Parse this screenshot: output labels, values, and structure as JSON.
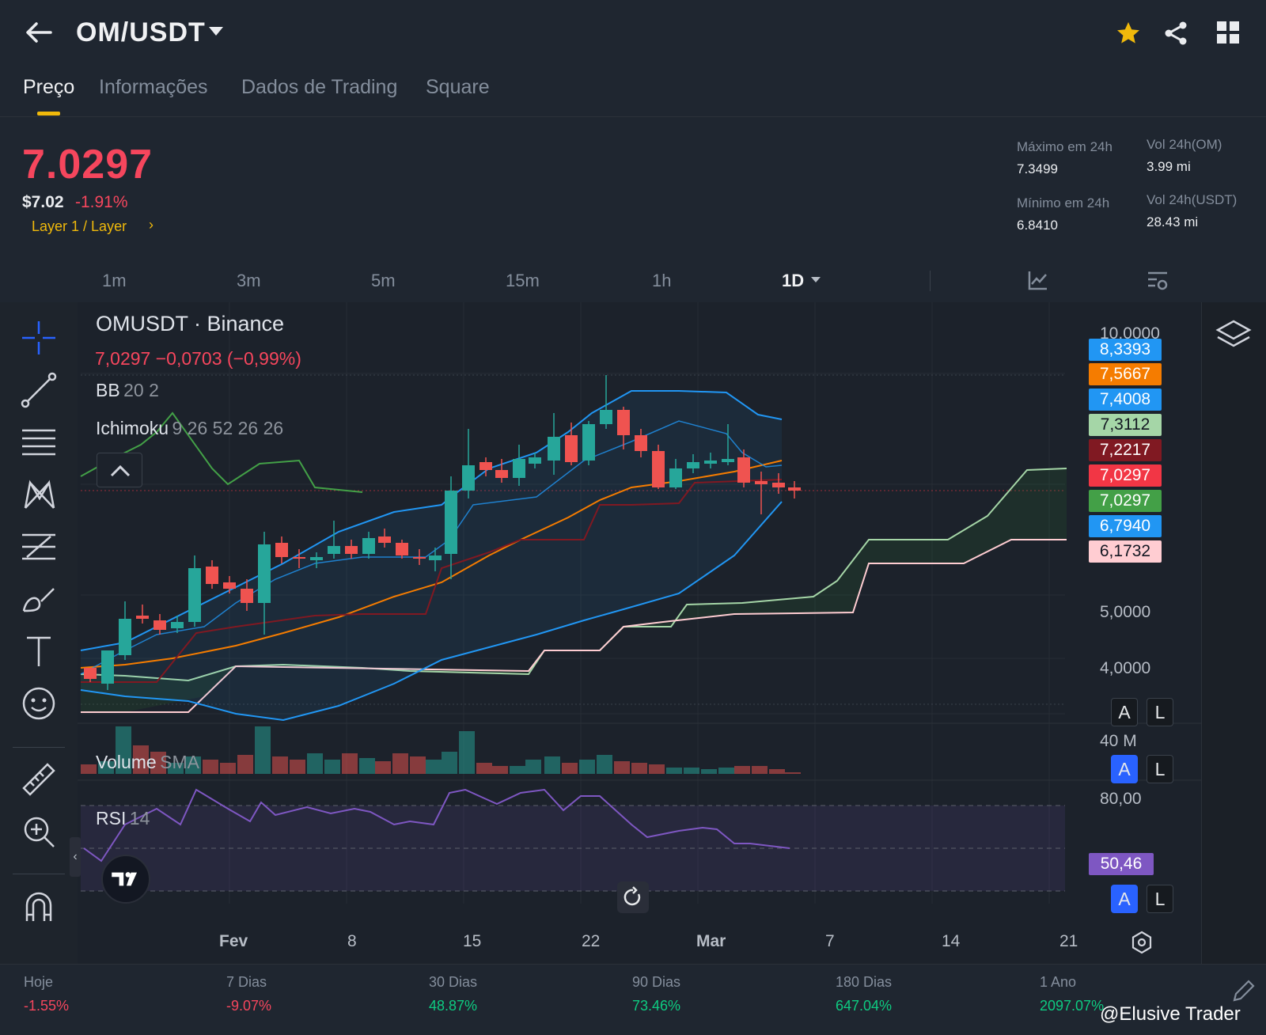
{
  "header": {
    "pair": "OM/USDT",
    "icons": [
      "back-arrow-icon",
      "chevron-down-icon",
      "star-icon",
      "share-icon",
      "grid-icon"
    ],
    "star_color": "#f0b90b"
  },
  "tabs": [
    "Preço",
    "Informações",
    "Dados de Trading",
    "Square"
  ],
  "price": {
    "last": "7.0297",
    "usd": "$7.02",
    "change_pct": "-1.91%",
    "category": "Layer 1 / Layer",
    "color": "#f6465d"
  },
  "stats": {
    "high_label": "Máximo em 24h",
    "high_value": "7.3499",
    "low_label": "Mínimo em 24h",
    "low_value": "6.8410",
    "vol_om_label": "Vol 24h(OM)",
    "vol_om_value": "3.99 mi",
    "vol_usdt_label": "Vol 24h(USDT)",
    "vol_usdt_value": "28.43 mi"
  },
  "intervals": [
    "1m",
    "3m",
    "5m",
    "15m",
    "1h",
    "1D"
  ],
  "chart": {
    "symbol": "OMUSDT · Binance",
    "ohlc_line": "7,0297  −0,0703 (−0,99%)",
    "bb_name": "BB",
    "bb_params": "20 2",
    "ichimoku_name": "Ichimoku",
    "ichimoku_params": "9 26 52 26 26",
    "volume_name": "Volume",
    "volume_params": "SMA",
    "rsi_name": "RSI",
    "rsi_params": "14",
    "rsi_value": "50,46",
    "price_axis": [
      "10,0000",
      "5,0000",
      "4,0000"
    ],
    "volume_axis": "40 M",
    "rsi_axis": "80,00",
    "price_tags": [
      {
        "value": "8,3393",
        "color": "#2196f3"
      },
      {
        "value": "7,5667",
        "color": "#f57c00"
      },
      {
        "value": "7,4008",
        "color": "#2196f3"
      },
      {
        "value": "7,3112",
        "color": "#a5d6a7"
      },
      {
        "value": "7,2217",
        "color": "#801922"
      },
      {
        "value": "7,0297",
        "color": "#f23645"
      },
      {
        "value": "7,0297",
        "color": "#43a047"
      },
      {
        "value": "6,7940",
        "color": "#2196f3"
      },
      {
        "value": "6,1732",
        "color": "#ffcdd2"
      }
    ],
    "date_labels": [
      "Fev",
      "8",
      "15",
      "22",
      "Mar",
      "7",
      "14",
      "21"
    ],
    "al_buttons": [
      "A",
      "L"
    ],
    "tools": [
      "crosshair-icon",
      "trend-line-icon",
      "horizontal-lines-icon",
      "pattern-icon",
      "fib-icon",
      "brush-icon",
      "text-icon",
      "emoji-icon",
      "ruler-icon",
      "zoom-in-icon",
      "magnet-icon"
    ]
  },
  "performance": [
    {
      "label": "Hoje",
      "value": "-1.55%"
    },
    {
      "label": "7 Dias",
      "value": "-9.07%"
    },
    {
      "label": "30 Dias",
      "value": "48.87%"
    },
    {
      "label": "90 Dias",
      "value": "73.46%"
    },
    {
      "label": "180 Dias",
      "value": "647.04%"
    },
    {
      "label": "1 Ano",
      "value": "2097.07%"
    }
  ],
  "watermark": "@Elusive Trader"
}
